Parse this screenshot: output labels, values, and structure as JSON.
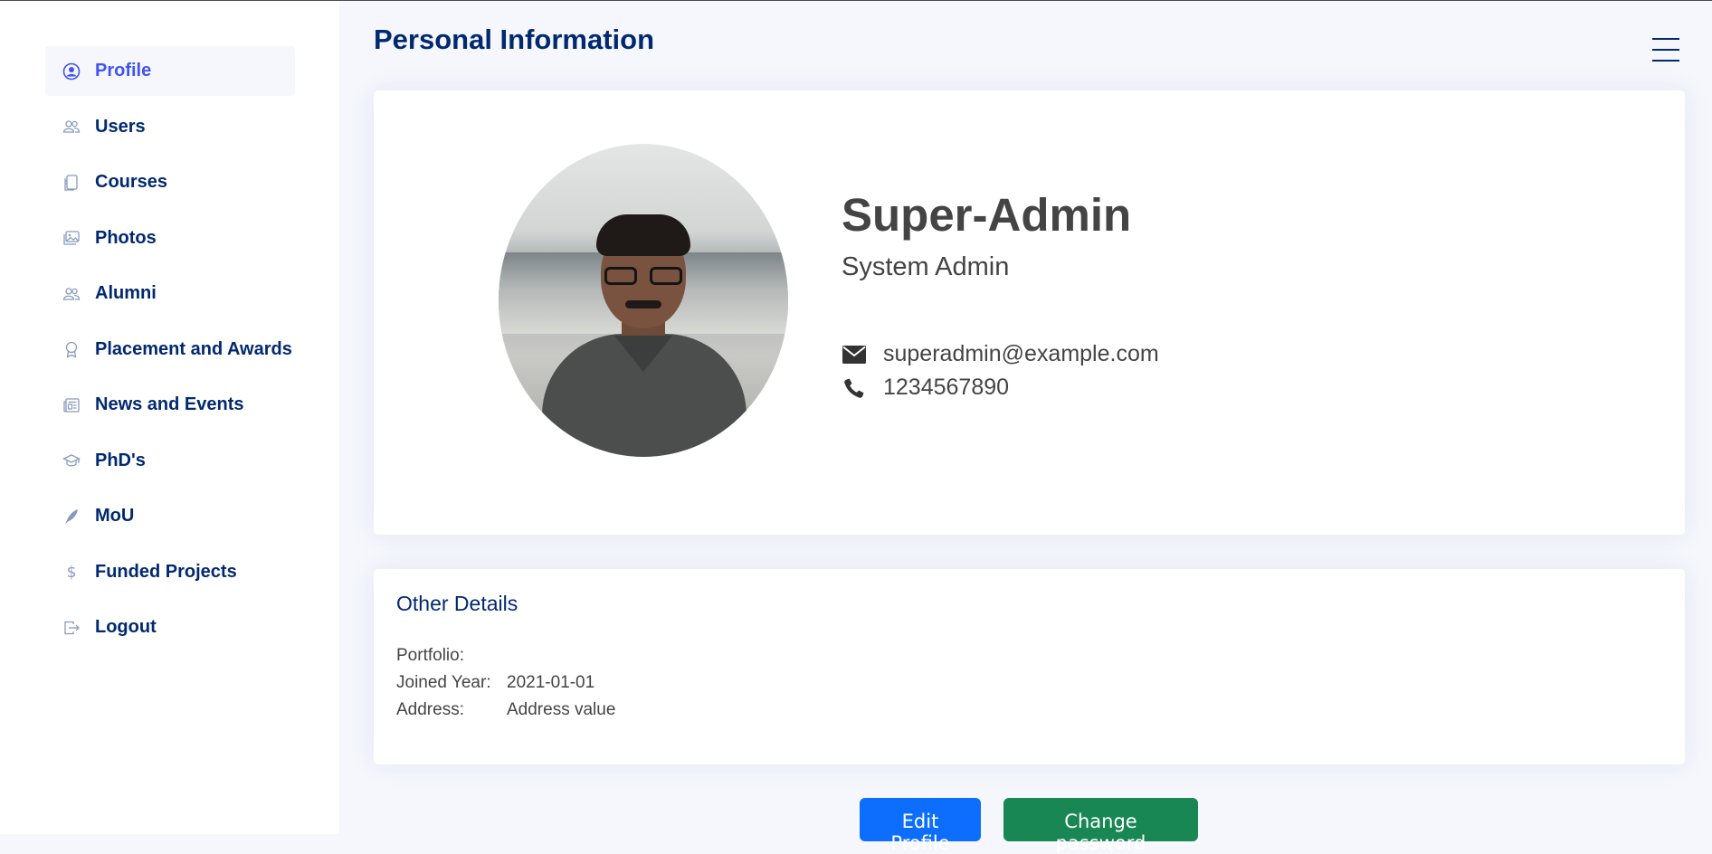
{
  "page": {
    "title": "Personal Information"
  },
  "sidebar": {
    "items": [
      {
        "label": "Profile",
        "icon": "person-circle-icon",
        "active": true
      },
      {
        "label": "Users",
        "icon": "people-icon"
      },
      {
        "label": "Courses",
        "icon": "journals-icon"
      },
      {
        "label": "Photos",
        "icon": "images-icon"
      },
      {
        "label": "Alumni",
        "icon": "people-icon"
      },
      {
        "label": "Placement and Awards",
        "icon": "award-icon"
      },
      {
        "label": "News and Events",
        "icon": "newspaper-icon"
      },
      {
        "label": "PhD's",
        "icon": "mortarboard-icon"
      },
      {
        "label": "MoU",
        "icon": "feather-icon"
      },
      {
        "label": "Funded Projects",
        "icon": "dollar-icon"
      },
      {
        "label": "Logout",
        "icon": "box-arrow-right-icon"
      }
    ]
  },
  "profile": {
    "name": "Super-Admin",
    "role": "System Admin",
    "email": "superadmin@example.com",
    "phone": "1234567890"
  },
  "details": {
    "title": "Other Details",
    "portfolio_label": "Portfolio:",
    "portfolio_value": "",
    "joined_label": "Joined Year:",
    "joined_value": "2021-01-01",
    "address_label": "Address:",
    "address_value": "Address value"
  },
  "actions": {
    "edit_label": "Edit Profile",
    "password_label": "Change password"
  },
  "colors": {
    "primary_navy": "#012970",
    "active_blue": "#4154f1",
    "edit_button": "#0d6efd",
    "password_button": "#198754"
  }
}
